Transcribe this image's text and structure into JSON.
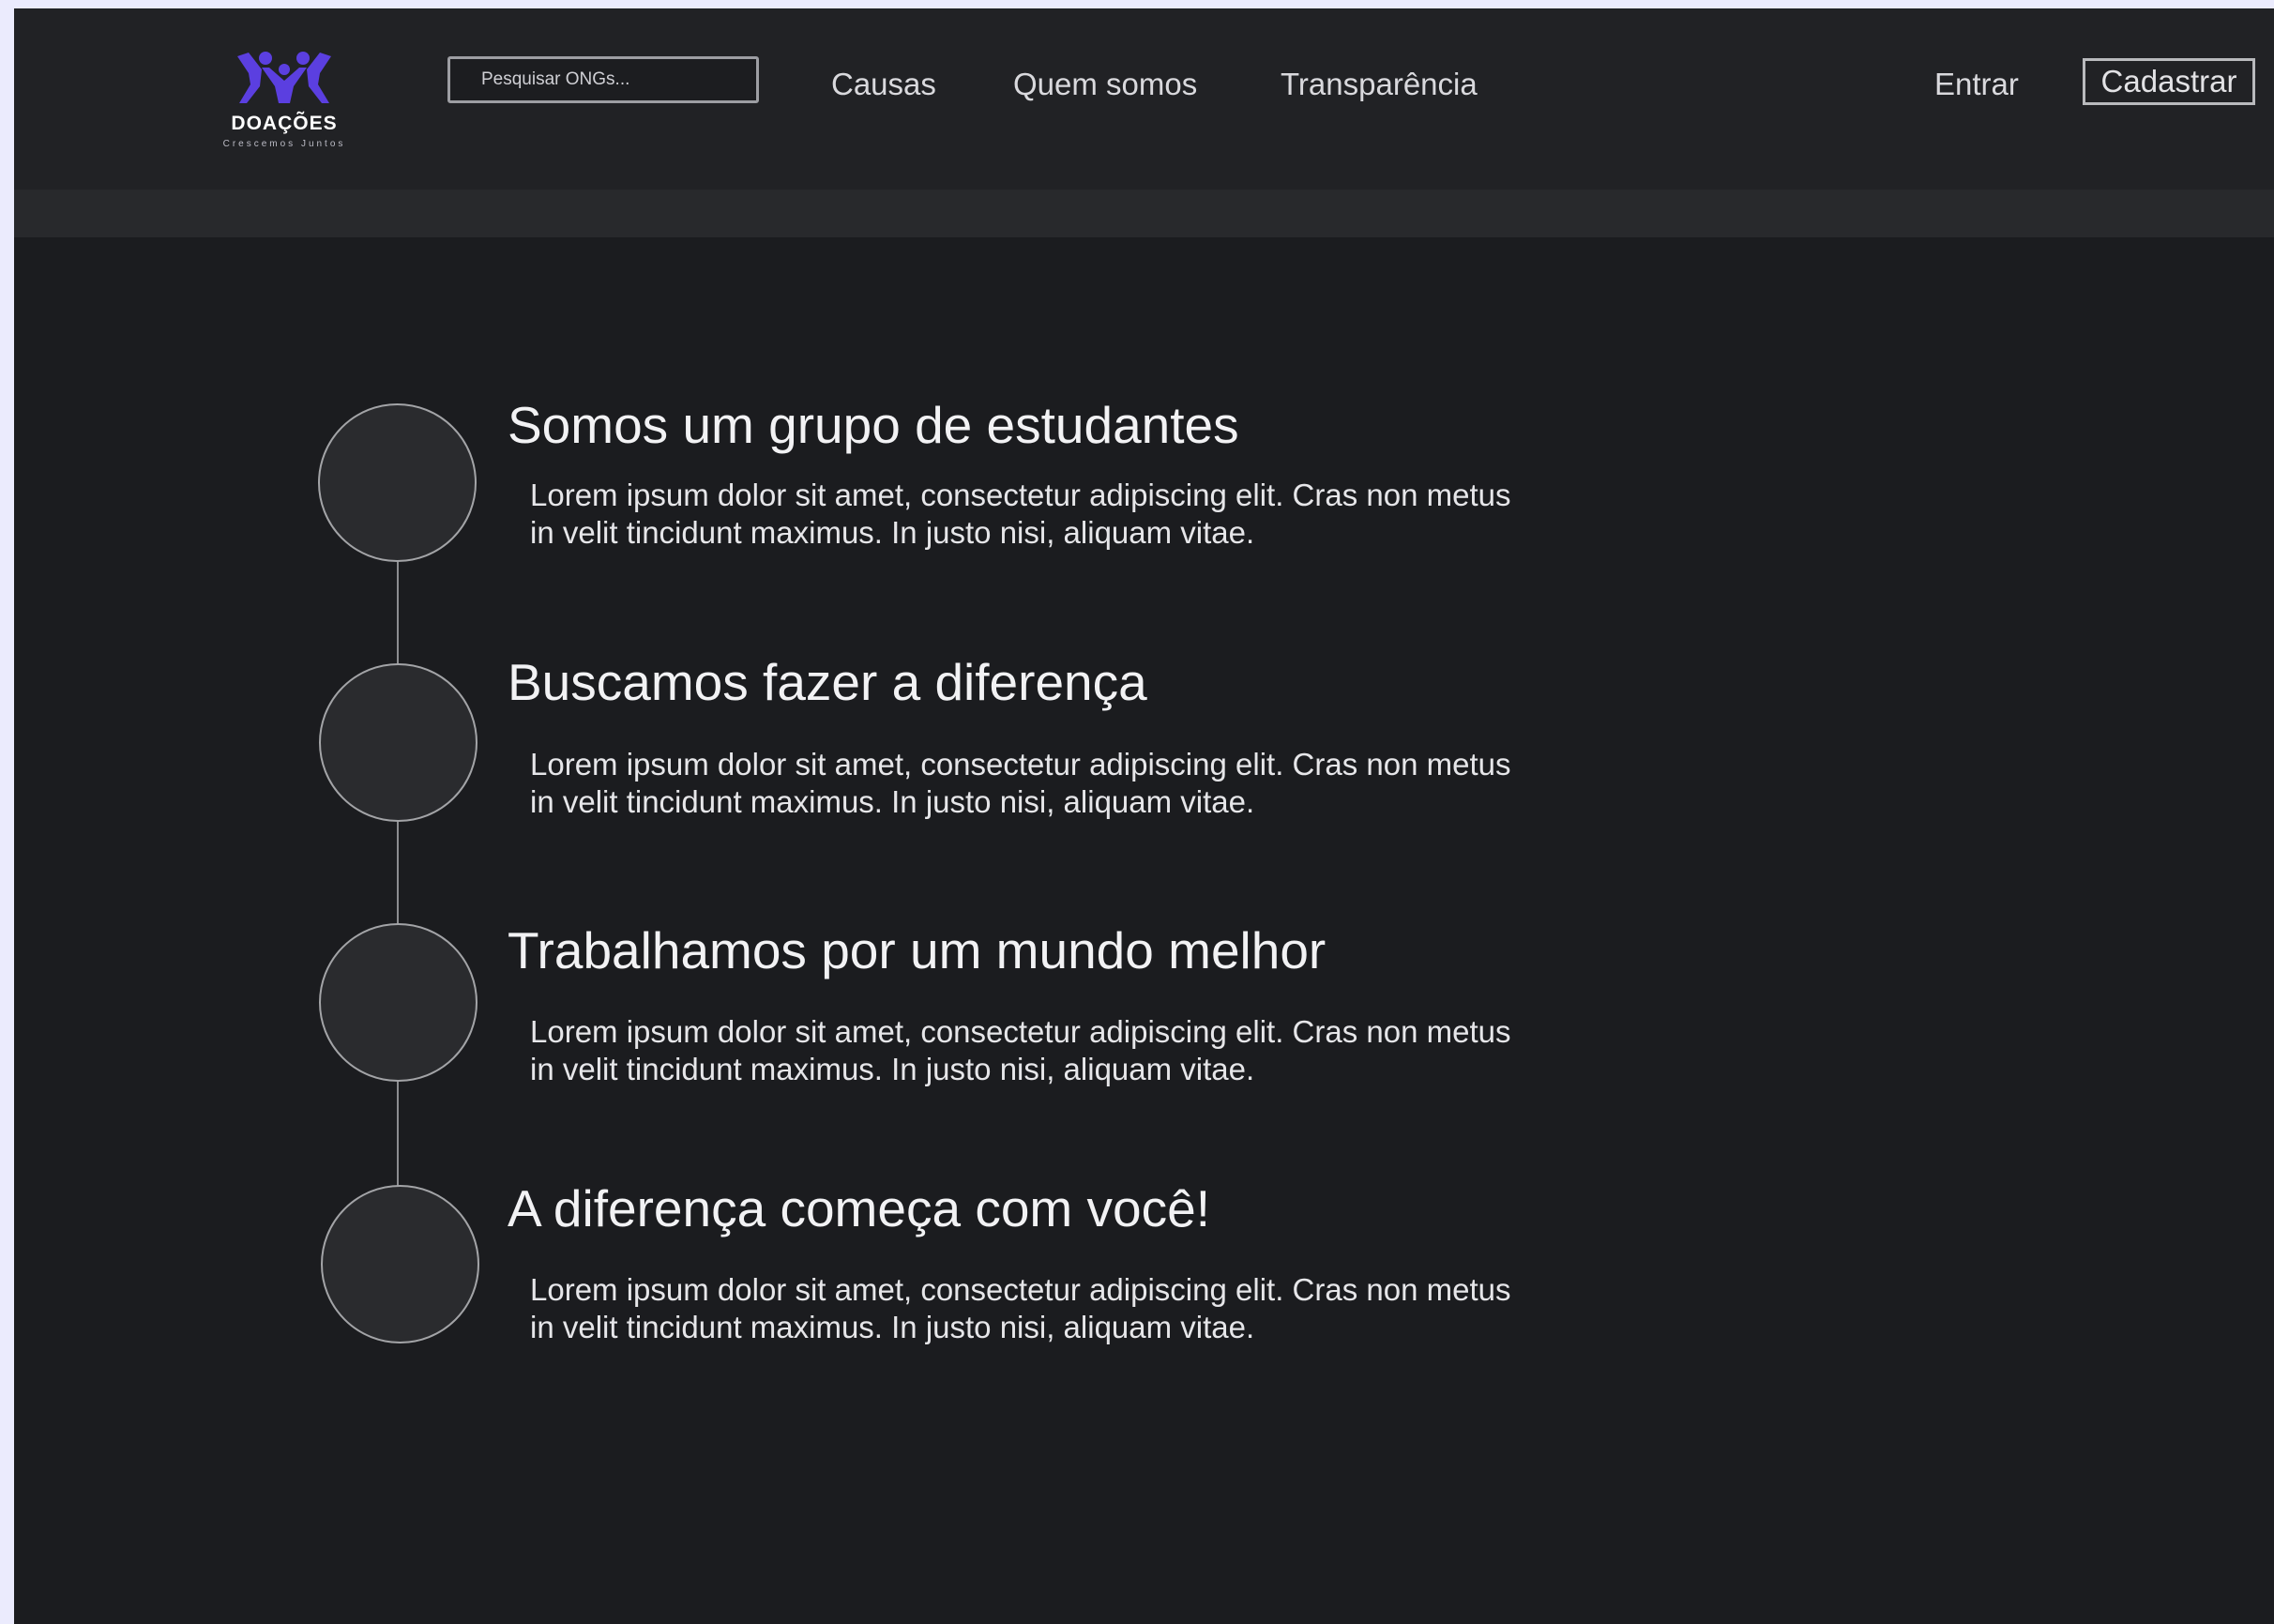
{
  "brand": {
    "name": "DOAÇÕES",
    "tagline": "Crescemos Juntos",
    "accent_color": "#5b3fe0",
    "logo_icon": "people-together-icon"
  },
  "header": {
    "search_placeholder": "Pesquisar ONGs...",
    "nav": [
      {
        "label": "Causas"
      },
      {
        "label": "Quem somos"
      },
      {
        "label": "Transparência"
      }
    ],
    "login_label": "Entrar",
    "signup_label": "Cadastrar"
  },
  "timeline": {
    "items": [
      {
        "title": "Somos um grupo de estudantes",
        "text": "Lorem ipsum dolor sit amet, consectetur adipiscing elit. Cras non metus in velit tincidunt maximus. In justo nisi, aliquam vitae."
      },
      {
        "title": "Buscamos fazer a diferença",
        "text": "Lorem ipsum dolor sit amet, consectetur adipiscing elit. Cras non metus in velit tincidunt maximus. In justo nisi, aliquam vitae."
      },
      {
        "title": "Trabalhamos por um mundo melhor",
        "text": "Lorem ipsum dolor sit amet, consectetur adipiscing elit. Cras non metus in velit tincidunt maximus. In justo nisi, aliquam vitae."
      },
      {
        "title": "A diferença começa com você!",
        "text": "Lorem ipsum dolor sit amet, consectetur adipiscing elit. Cras non metus in velit tincidunt maximus. In justo nisi, aliquam vitae."
      }
    ]
  }
}
